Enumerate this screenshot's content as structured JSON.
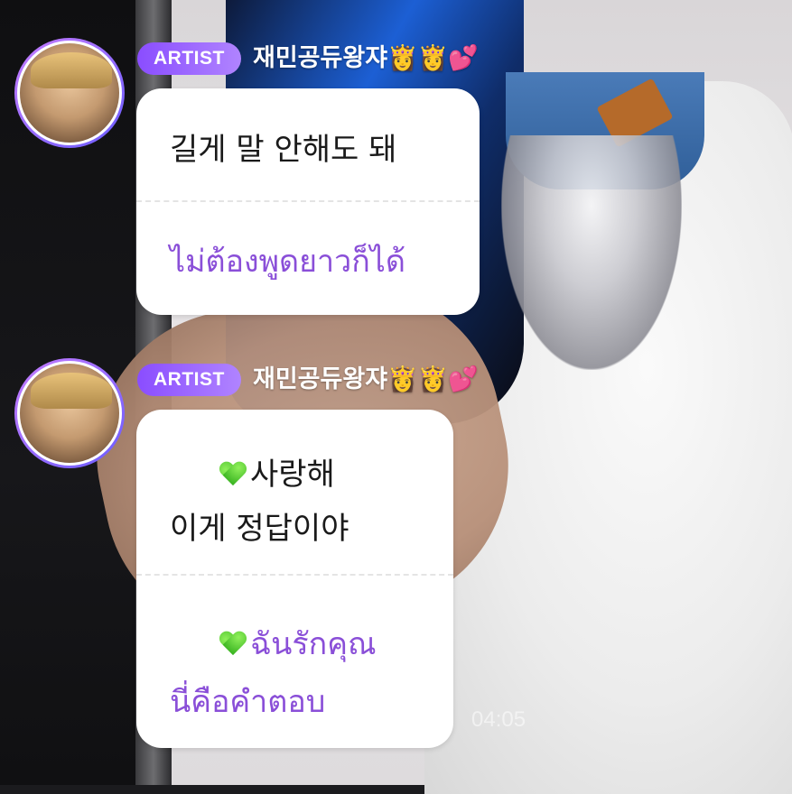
{
  "messages": [
    {
      "badge": "ARTIST",
      "nickname": "재민공듀왕쟈👸👸💕",
      "original": "길게 말 안해도 돼",
      "translation": "ไม่ต้องพูดยาวก็ได้"
    },
    {
      "badge": "ARTIST",
      "nickname": "재민공듀왕쟈👸👸💕",
      "original_line1": "사랑해",
      "original_line2": "이게 정답이야",
      "translation_line1": "ฉันรักคุณ",
      "translation_line2": "นี่คือคำตอบ"
    }
  ],
  "video_time": "04:05",
  "icons": {
    "heart": "green-heart-icon"
  },
  "colors": {
    "badge": "#8a4dff",
    "translation_text": "#8a4fd8",
    "bubble": "#ffffff"
  }
}
